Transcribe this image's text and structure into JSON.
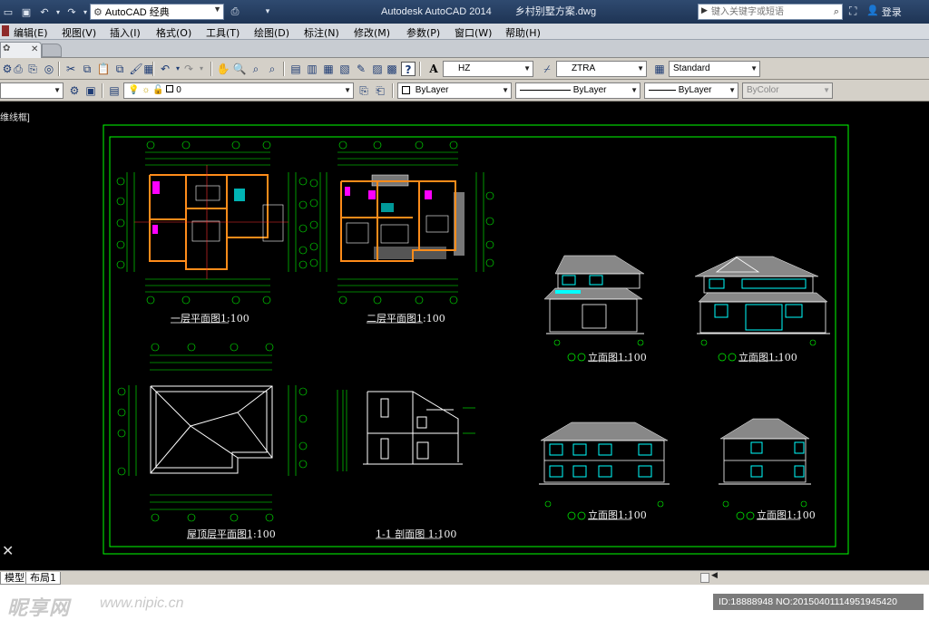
{
  "titlebar": {
    "workspace": "AutoCAD 经典",
    "app_name": "Autodesk AutoCAD 2014",
    "file_name": "乡村别墅方案.dwg",
    "search_placeholder": "键入关键字或短语",
    "login_label": "登录"
  },
  "menu": {
    "items": [
      "编辑(E)",
      "视图(V)",
      "插入(I)",
      "格式(O)",
      "工具(T)",
      "绘图(D)",
      "标注(N)",
      "修改(M)",
      "参数(P)",
      "窗口(W)",
      "帮助(H)"
    ]
  },
  "styles": {
    "text_style": "HZ",
    "dim_style": "ZTRA",
    "table_style": "Standard"
  },
  "layers": {
    "current_layer": "0",
    "color": "ByLayer",
    "linetype": "ByLayer",
    "lineweight": "ByLayer",
    "plotstyle": "ByColor"
  },
  "viewport": {
    "label": "维线框]"
  },
  "drawing": {
    "captions": {
      "plan1": "一层平面图1:100",
      "plan2": "二层平面图1:100",
      "roof": "屋顶层平面图1:100",
      "section": "1-1 剖面图 1:100",
      "elev1": "立面图1:100",
      "elev2": "立面图1:100",
      "elev3": "立面图1:100",
      "elev4": "立面图1:100"
    }
  },
  "layout_tabs": [
    "模型",
    "布局1"
  ],
  "watermark": {
    "logo": "昵享网",
    "url": "www.nipic.cn",
    "id": "ID:18888948 NO:20150401114951945420"
  },
  "colors": {
    "frame": "#00ff00",
    "walls": "#ff8c1a",
    "dims": "#00ff00",
    "windows": "#00ffff",
    "roof": "#9a9a9a"
  }
}
